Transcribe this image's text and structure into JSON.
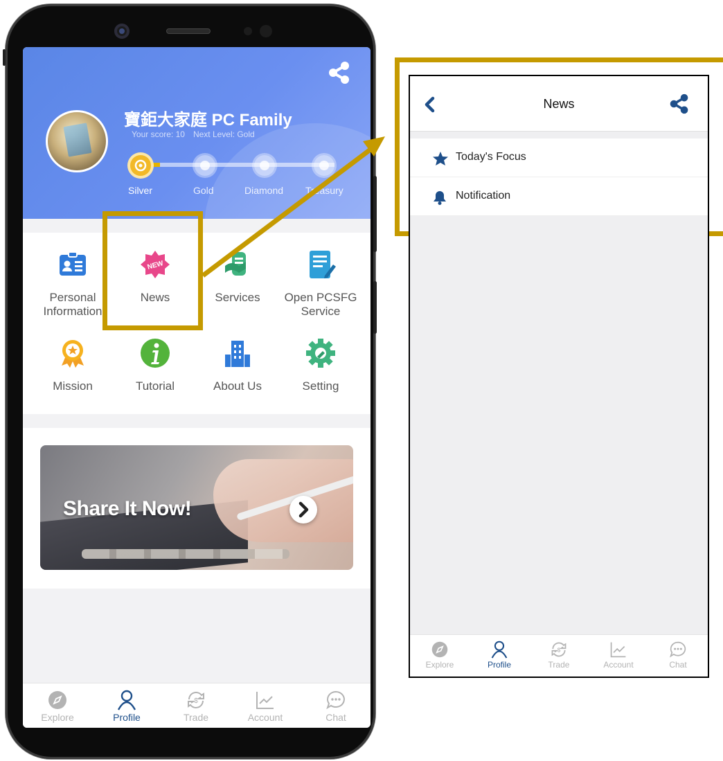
{
  "app": {
    "user_name": "寶鉅大家庭 PC Family",
    "score_text": "Your score: 10",
    "next_level_text": "Next Level: Gold",
    "levels": [
      "Silver",
      "Gold",
      "Diamond",
      "Treasury"
    ],
    "current_level": "Silver",
    "level_progress": 0.1
  },
  "menu": [
    {
      "label": "Personal\nInformation",
      "icon": "id-card-icon"
    },
    {
      "label": "News",
      "icon": "new-badge-icon"
    },
    {
      "label": "Services",
      "icon": "services-icon"
    },
    {
      "label": "Open PCSFG\nService",
      "icon": "document-icon"
    },
    {
      "label": "Mission",
      "icon": "medal-icon"
    },
    {
      "label": "Tutorial",
      "icon": "info-icon"
    },
    {
      "label": "About Us",
      "icon": "building-icon"
    },
    {
      "label": "Setting",
      "icon": "gear-icon"
    }
  ],
  "banner": {
    "title": "Share It Now!"
  },
  "tabs": [
    {
      "label": "Explore",
      "icon": "compass-icon"
    },
    {
      "label": "Profile",
      "icon": "person-icon",
      "active": true
    },
    {
      "label": "Trade",
      "icon": "exchange-icon"
    },
    {
      "label": "Account",
      "icon": "chart-icon"
    },
    {
      "label": "Chat",
      "icon": "chat-icon"
    }
  ],
  "news_page": {
    "title": "News",
    "items": [
      {
        "label": "Today's Focus",
        "icon": "star-icon"
      },
      {
        "label": "Notification",
        "icon": "bell-icon"
      }
    ]
  },
  "colors": {
    "highlight": "#c59a00",
    "header_blue": "#5a86e6",
    "nav_active": "#1e4f8a",
    "nav_inactive": "#b3b3b3"
  }
}
